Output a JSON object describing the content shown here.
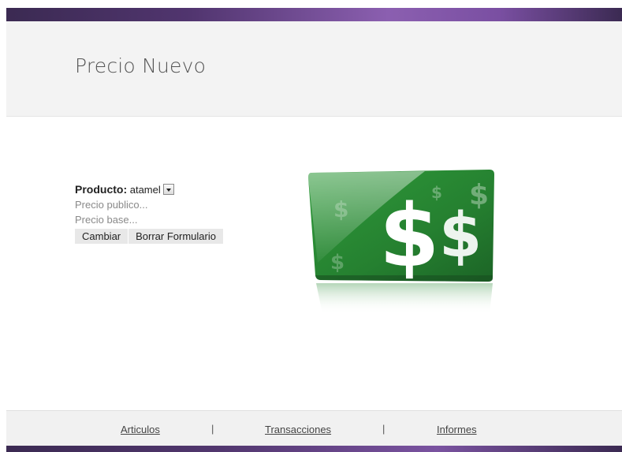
{
  "header": {
    "title": "Precio Nuevo"
  },
  "form": {
    "producto_label": "Producto:",
    "producto_value": "atamel",
    "precio_publico_placeholder": "Precio publico...",
    "precio_base_placeholder": "Precio base...",
    "cambiar_label": "Cambiar",
    "borrar_label": "Borrar Formulario"
  },
  "image": {
    "icon": "dollar-card-icon",
    "colors": {
      "green": "#2f8a3a",
      "dark_green": "#1f5f28"
    }
  },
  "footer": {
    "links": [
      {
        "label": "Articulos"
      },
      {
        "label": "Transacciones"
      },
      {
        "label": "Informes"
      }
    ],
    "separator": "|"
  },
  "colors": {
    "accent": "#51356f",
    "header_bg": "#f3f3f3"
  }
}
